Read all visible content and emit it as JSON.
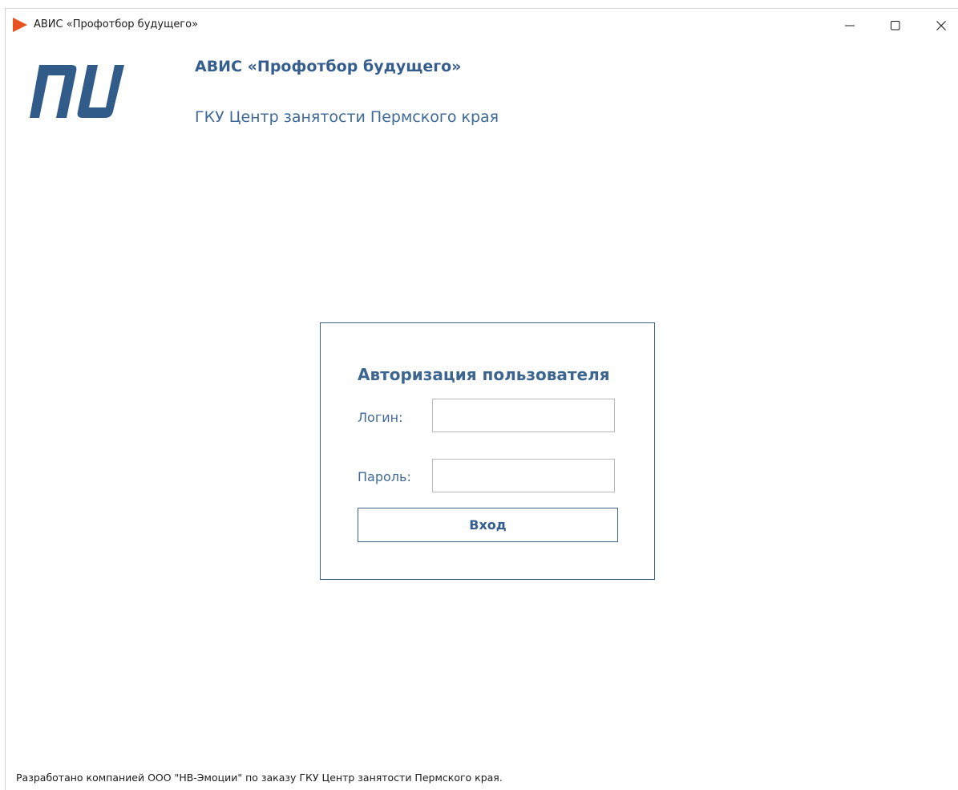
{
  "window": {
    "title": "АВИС «Профотбор будущего»",
    "icon": "play-triangle-icon",
    "controls": {
      "minimize": "minimize-icon",
      "maximize": "maximize-icon",
      "close": "close-icon"
    }
  },
  "header": {
    "logo_icon": "nu-logo-icon",
    "app_title": "АВИС «Профотбор будущего»",
    "organization": "ГКУ Центр занятости Пермского края"
  },
  "login": {
    "heading": "Авторизация пользователя",
    "login_label": "Логин:",
    "login_value": "",
    "password_label": "Пароль:",
    "password_value": "",
    "submit_label": "Вход"
  },
  "footer": {
    "text": "Разработано компанией ООО \"НВ-Эмоции\" по заказу ГКУ Центр занятости Пермского края."
  },
  "colors": {
    "accent": "#355e8f",
    "app_icon": "#e8521f",
    "border": "#3d6391"
  }
}
